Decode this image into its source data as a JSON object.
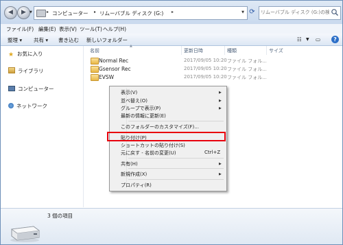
{
  "address": {
    "crumbs": [
      "コンピューター",
      "リムーバブル ディスク (G:)"
    ],
    "search_placeholder": "リムーバブル ディスク (G:)の検索"
  },
  "menu": [
    "ファイル(F)",
    "編集(E)",
    "表示(V)",
    "ツール(T)",
    "ヘルプ(H)"
  ],
  "toolbar": {
    "organize": "整理",
    "share": "共有",
    "burn": "書き込む",
    "new_folder": "新しいフォルダー"
  },
  "nav": {
    "favorites": "お気に入り",
    "libraries": "ライブラリ",
    "computer": "コンピューター",
    "network": "ネットワーク"
  },
  "columns": {
    "name": "名前",
    "date": "更新日時",
    "type": "種類",
    "size": "サイズ"
  },
  "files": [
    {
      "name": "Normal Rec",
      "date": "2017/09/05 10:20",
      "type": "ファイル フォル..."
    },
    {
      "name": "Gsensor Rec",
      "date": "2017/09/05 10:20",
      "type": "ファイル フォル..."
    },
    {
      "name": "EVSW",
      "date": "2017/09/05 10:20",
      "type": "ファイル フォル..."
    }
  ],
  "context_menu": {
    "view": "表示(V)",
    "sort_by": "並べ替え(O)",
    "group_by": "グループで表示(P)",
    "refresh": "最新の情報に更新(E)",
    "customize": "このフォルダーのカスタマイズ(F)...",
    "paste": "貼り付け(P)",
    "paste_shortcut": "ショートカットの貼り付け(S)",
    "undo": "元に戻す - 名前の変更(U)",
    "undo_shortcut": "Ctrl+Z",
    "share": "共有(H)",
    "new": "新規作成(X)",
    "properties": "プロパティ(R)"
  },
  "details": {
    "item_count": "3 個の項目"
  },
  "colors": {
    "highlight_border": "#e8000d",
    "accent": "#2c6fc8"
  }
}
